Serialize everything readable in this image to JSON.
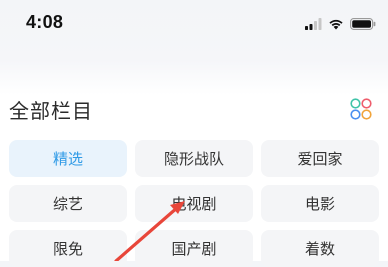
{
  "status_bar": {
    "time": "4:08",
    "icons": [
      "signal-icon",
      "wifi-icon",
      "battery-icon"
    ]
  },
  "header": {
    "title": "全部栏目"
  },
  "grid": {
    "items": [
      {
        "label": "精选",
        "selected": true
      },
      {
        "label": "隐形战队",
        "selected": false
      },
      {
        "label": "爱回家",
        "selected": false
      },
      {
        "label": "综艺",
        "selected": false
      },
      {
        "label": "电视剧",
        "selected": false
      },
      {
        "label": "电影",
        "selected": false
      },
      {
        "label": "限免",
        "selected": false
      },
      {
        "label": "国产剧",
        "selected": false
      },
      {
        "label": "着数",
        "selected": false
      }
    ]
  },
  "colors": {
    "accent": "#2f9ae6",
    "selected_bg": "#e9f3fc",
    "cell_bg": "#f4f5f7",
    "annotation_arrow": "#e8463a"
  }
}
